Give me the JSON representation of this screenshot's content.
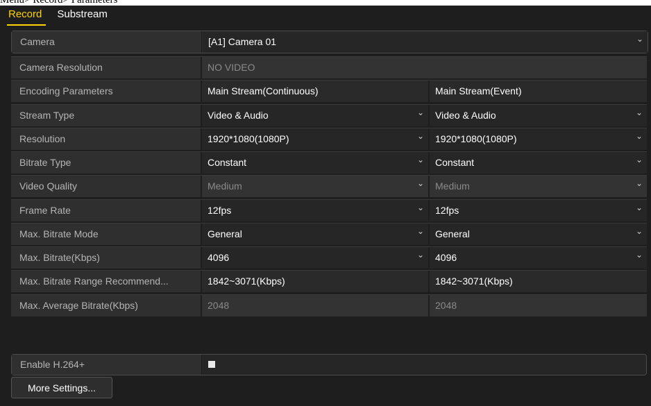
{
  "crumb": "Menu> Record> Parameters",
  "tabs": {
    "record": "Record",
    "substream": "Substream"
  },
  "rows": {
    "camera": {
      "label": "Camera",
      "value": "[A1] Camera 01"
    },
    "resolution_cam": {
      "label": "Camera Resolution",
      "value": "NO VIDEO"
    },
    "encoding": {
      "label": "Encoding Parameters",
      "main": "Main Stream(Continuous)",
      "event": "Main Stream(Event)"
    },
    "stream_type": {
      "label": "Stream Type",
      "main": "Video & Audio",
      "event": "Video & Audio"
    },
    "resolution": {
      "label": "Resolution",
      "main": "1920*1080(1080P)",
      "event": "1920*1080(1080P)"
    },
    "bitrate_type": {
      "label": "Bitrate Type",
      "main": "Constant",
      "event": "Constant"
    },
    "video_quality": {
      "label": "Video Quality",
      "main": "Medium",
      "event": "Medium"
    },
    "frame_rate": {
      "label": "Frame Rate",
      "main": "12fps",
      "event": "12fps"
    },
    "max_bitrate_mode": {
      "label": "Max. Bitrate Mode",
      "main": "General",
      "event": "General"
    },
    "max_bitrate": {
      "label": "Max. Bitrate(Kbps)",
      "main": "4096",
      "event": "4096"
    },
    "range_recommend": {
      "label": "Max. Bitrate Range Recommend...",
      "main": "1842~3071(Kbps)",
      "event": "1842~3071(Kbps)"
    },
    "max_avg_bitrate": {
      "label": "Max. Average Bitrate(Kbps)",
      "main": "2048",
      "event": "2048"
    }
  },
  "h264": {
    "label": "Enable H.264+",
    "checked": false
  },
  "more_settings": "More Settings..."
}
